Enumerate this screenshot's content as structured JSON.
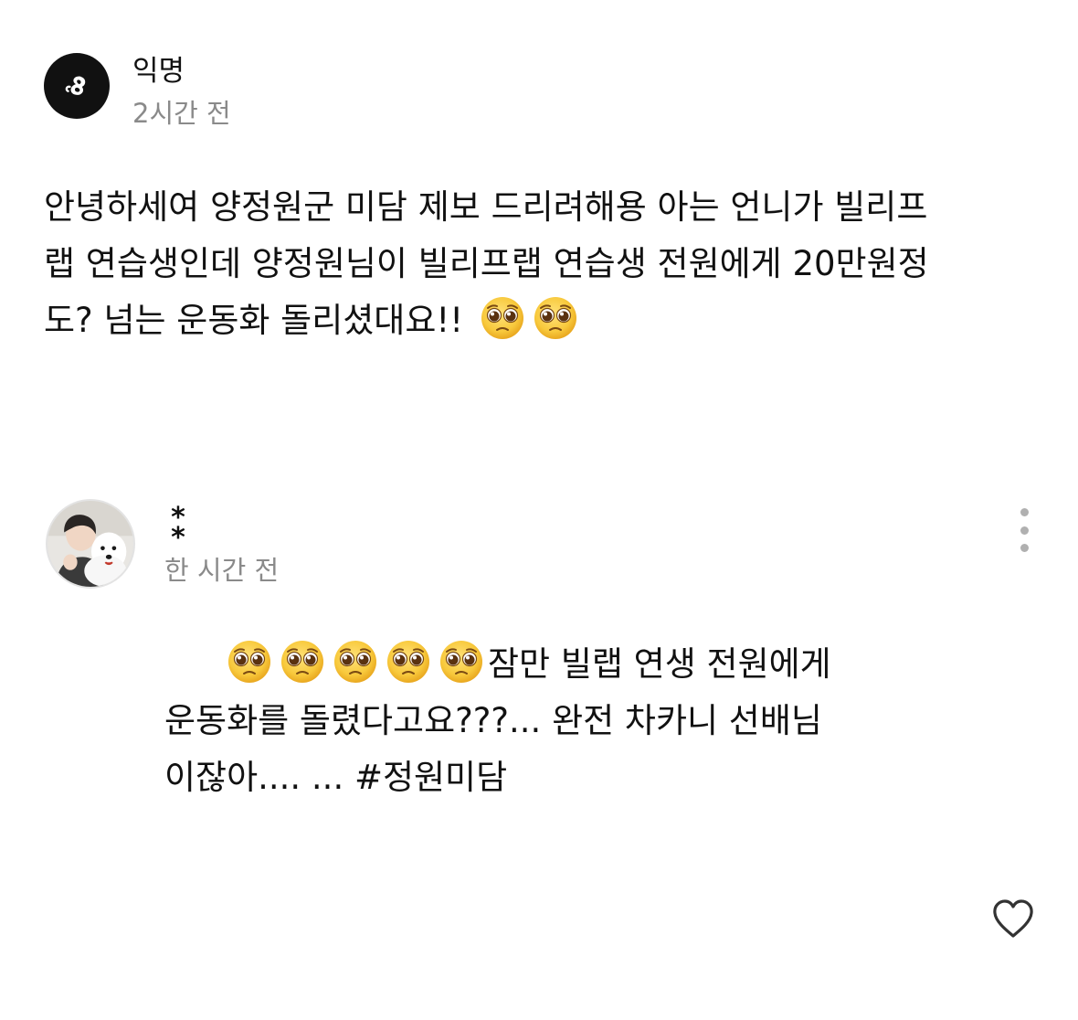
{
  "post": {
    "author": "익명",
    "time": "2시간 전",
    "body_line1": "안녕하세여 양정원군 미담 제보 드리려해용 아는 언니가 빌리프",
    "body_line2": "랩 연습생인데 양정원님이 빌리프랩 연습생 전원에게 20만원정",
    "body_line3": "도? 넘는 운동화 돌리셨대요!!"
  },
  "comment": {
    "author": "**",
    "author_star1": "*",
    "author_star2": "*",
    "time": "한 시간 전",
    "line1": "잠만 빌랩 연생 전원에게",
    "line2": "운동화를 돌렸다고요???... 완전 차카니 선배님",
    "line3": "이잖아.... ... #정원미담"
  },
  "icons": {
    "post_avatar": "anonymous-logo-icon",
    "emoji": "pleading-face-emoji",
    "more": "more-vertical-icon",
    "like": "heart-outline-icon"
  },
  "colors": {
    "text": "#111111",
    "muted": "#8a8a8a",
    "emoji_face": "#f8c93c"
  }
}
